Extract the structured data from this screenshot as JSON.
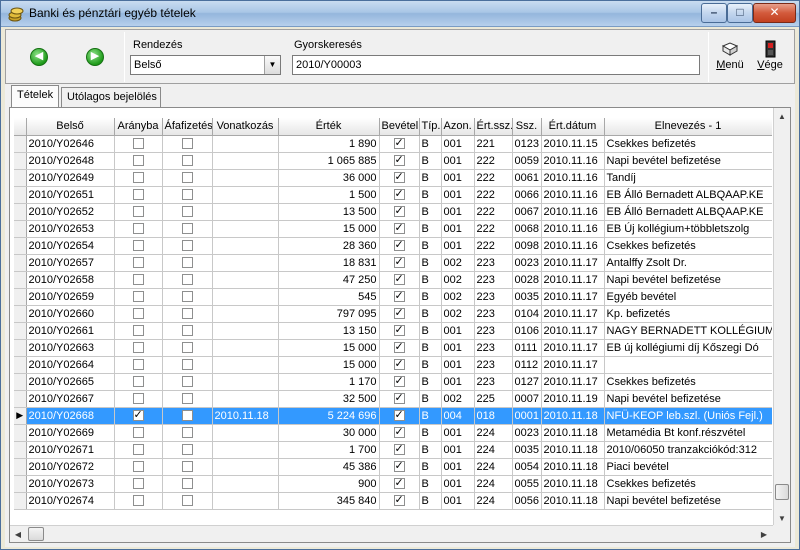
{
  "window": {
    "title": "Banki és pénztári egyéb tételek",
    "min_label": "–",
    "max_label": "□",
    "close_label": "✕"
  },
  "toolbar": {
    "back_icon": "arrow-left-icon",
    "forward_icon": "arrow-right-icon",
    "sort_label": "Rendezés",
    "sort_value": "Belső",
    "search_label": "Gyorskeresés",
    "search_value": "2010/Y00003",
    "menu_prefix": "M",
    "menu_rest": "enü",
    "exit_prefix": "V",
    "exit_rest": "ége"
  },
  "tabs": [
    {
      "label": "Tételek",
      "active": true
    },
    {
      "label": "Utólagos bejelölés",
      "active": false
    }
  ],
  "columns": [
    "Belső",
    "Arányba",
    "Áfafizetés",
    "Vonatkozás",
    "Érték",
    "Bevétel",
    "Típ.",
    "Azon.",
    "Ért.ssz.",
    "Ssz.",
    "Ért.dátum",
    "Elnevezés - 1"
  ],
  "rows": [
    {
      "belso": "2010/Y02646",
      "aranyba": false,
      "afa": false,
      "vonatkozas": "",
      "ertek": "1 890",
      "bevetel": true,
      "tip": "B",
      "azon": "001",
      "ertssz": "221",
      "ssz": "0123",
      "datum": "2010.11.15",
      "nev": "Csekkes befizetés"
    },
    {
      "belso": "2010/Y02648",
      "aranyba": false,
      "afa": false,
      "vonatkozas": "",
      "ertek": "1 065 885",
      "bevetel": true,
      "tip": "B",
      "azon": "001",
      "ertssz": "222",
      "ssz": "0059",
      "datum": "2010.11.16",
      "nev": "Napi bevétel befizetése"
    },
    {
      "belso": "2010/Y02649",
      "aranyba": false,
      "afa": false,
      "vonatkozas": "",
      "ertek": "36 000",
      "bevetel": true,
      "tip": "B",
      "azon": "001",
      "ertssz": "222",
      "ssz": "0061",
      "datum": "2010.11.16",
      "nev": "Tandíj"
    },
    {
      "belso": "2010/Y02651",
      "aranyba": false,
      "afa": false,
      "vonatkozas": "",
      "ertek": "1 500",
      "bevetel": true,
      "tip": "B",
      "azon": "001",
      "ertssz": "222",
      "ssz": "0066",
      "datum": "2010.11.16",
      "nev": "EB Álló Bernadett ALBQAAP.KE"
    },
    {
      "belso": "2010/Y02652",
      "aranyba": false,
      "afa": false,
      "vonatkozas": "",
      "ertek": "13 500",
      "bevetel": true,
      "tip": "B",
      "azon": "001",
      "ertssz": "222",
      "ssz": "0067",
      "datum": "2010.11.16",
      "nev": "EB Álló Bernadett ALBQAAP.KE"
    },
    {
      "belso": "2010/Y02653",
      "aranyba": false,
      "afa": false,
      "vonatkozas": "",
      "ertek": "15 000",
      "bevetel": true,
      "tip": "B",
      "azon": "001",
      "ertssz": "222",
      "ssz": "0068",
      "datum": "2010.11.16",
      "nev": "EB Új kollégium+többletszolg"
    },
    {
      "belso": "2010/Y02654",
      "aranyba": false,
      "afa": false,
      "vonatkozas": "",
      "ertek": "28 360",
      "bevetel": true,
      "tip": "B",
      "azon": "001",
      "ertssz": "222",
      "ssz": "0098",
      "datum": "2010.11.16",
      "nev": "Csekkes befizetés"
    },
    {
      "belso": "2010/Y02657",
      "aranyba": false,
      "afa": false,
      "vonatkozas": "",
      "ertek": "18 831",
      "bevetel": true,
      "tip": "B",
      "azon": "002",
      "ertssz": "223",
      "ssz": "0023",
      "datum": "2010.11.17",
      "nev": "Antalffy Zsolt Dr."
    },
    {
      "belso": "2010/Y02658",
      "aranyba": false,
      "afa": false,
      "vonatkozas": "",
      "ertek": "47 250",
      "bevetel": true,
      "tip": "B",
      "azon": "002",
      "ertssz": "223",
      "ssz": "0028",
      "datum": "2010.11.17",
      "nev": "Napi bevétel befizetése"
    },
    {
      "belso": "2010/Y02659",
      "aranyba": false,
      "afa": false,
      "vonatkozas": "",
      "ertek": "545",
      "bevetel": true,
      "tip": "B",
      "azon": "002",
      "ertssz": "223",
      "ssz": "0035",
      "datum": "2010.11.17",
      "nev": "Egyéb bevétel"
    },
    {
      "belso": "2010/Y02660",
      "aranyba": false,
      "afa": false,
      "vonatkozas": "",
      "ertek": "797 095",
      "bevetel": true,
      "tip": "B",
      "azon": "002",
      "ertssz": "223",
      "ssz": "0104",
      "datum": "2010.11.17",
      "nev": "Kp. befizetés"
    },
    {
      "belso": "2010/Y02661",
      "aranyba": false,
      "afa": false,
      "vonatkozas": "",
      "ertek": "13 150",
      "bevetel": true,
      "tip": "B",
      "azon": "001",
      "ertssz": "223",
      "ssz": "0106",
      "datum": "2010.11.17",
      "nev": "NAGY BERNADETT KOLLÉGIUMI D"
    },
    {
      "belso": "2010/Y02663",
      "aranyba": false,
      "afa": false,
      "vonatkozas": "",
      "ertek": "15 000",
      "bevetel": true,
      "tip": "B",
      "azon": "001",
      "ertssz": "223",
      "ssz": "0111",
      "datum": "2010.11.17",
      "nev": "EB új kollégiumi díj Kőszegi Dó"
    },
    {
      "belso": "2010/Y02664",
      "aranyba": false,
      "afa": false,
      "vonatkozas": "",
      "ertek": "15 000",
      "bevetel": true,
      "tip": "B",
      "azon": "001",
      "ertssz": "223",
      "ssz": "0112",
      "datum": "2010.11.17",
      "nev": ""
    },
    {
      "belso": "2010/Y02665",
      "aranyba": false,
      "afa": false,
      "vonatkozas": "",
      "ertek": "1 170",
      "bevetel": true,
      "tip": "B",
      "azon": "001",
      "ertssz": "223",
      "ssz": "0127",
      "datum": "2010.11.17",
      "nev": "Csekkes befizetés"
    },
    {
      "belso": "2010/Y02667",
      "aranyba": false,
      "afa": false,
      "vonatkozas": "",
      "ertek": "32 500",
      "bevetel": true,
      "tip": "B",
      "azon": "002",
      "ertssz": "225",
      "ssz": "0007",
      "datum": "2010.11.19",
      "nev": "Napi bevétel befizetése"
    },
    {
      "belso": "2010/Y02668",
      "aranyba": true,
      "afa": false,
      "vonatkozas": "2010.11.18",
      "ertek": "5 224 696",
      "bevetel": true,
      "tip": "B",
      "azon": "004",
      "ertssz": "018",
      "ssz": "0001",
      "datum": "2010.11.18",
      "nev": "NFÜ-KEOP leb.szl. (Uniós Fejl.)",
      "selected": true
    },
    {
      "belso": "2010/Y02669",
      "aranyba": false,
      "afa": false,
      "vonatkozas": "",
      "ertek": "30 000",
      "bevetel": true,
      "tip": "B",
      "azon": "001",
      "ertssz": "224",
      "ssz": "0023",
      "datum": "2010.11.18",
      "nev": " Metamédia Bt konf.részvétel"
    },
    {
      "belso": "2010/Y02671",
      "aranyba": false,
      "afa": false,
      "vonatkozas": "",
      "ertek": "1 700",
      "bevetel": true,
      "tip": "B",
      "azon": "001",
      "ertssz": "224",
      "ssz": "0035",
      "datum": "2010.11.18",
      "nev": "2010/06050 tranzakciókód:312"
    },
    {
      "belso": "2010/Y02672",
      "aranyba": false,
      "afa": false,
      "vonatkozas": "",
      "ertek": "45 386",
      "bevetel": true,
      "tip": "B",
      "azon": "001",
      "ertssz": "224",
      "ssz": "0054",
      "datum": "2010.11.18",
      "nev": "Piaci bevétel"
    },
    {
      "belso": "2010/Y02673",
      "aranyba": false,
      "afa": false,
      "vonatkozas": "",
      "ertek": "900",
      "bevetel": true,
      "tip": "B",
      "azon": "001",
      "ertssz": "224",
      "ssz": "0055",
      "datum": "2010.11.18",
      "nev": "Csekkes befizetés"
    },
    {
      "belso": "2010/Y02674",
      "aranyba": false,
      "afa": false,
      "vonatkozas": "",
      "ertek": "345 840",
      "bevetel": true,
      "tip": "B",
      "azon": "001",
      "ertssz": "224",
      "ssz": "0056",
      "datum": "2010.11.18",
      "nev": "Napi bevétel befizetése"
    }
  ],
  "colors": {
    "selection": "#3399ff",
    "accent": "#1f9b1a"
  }
}
